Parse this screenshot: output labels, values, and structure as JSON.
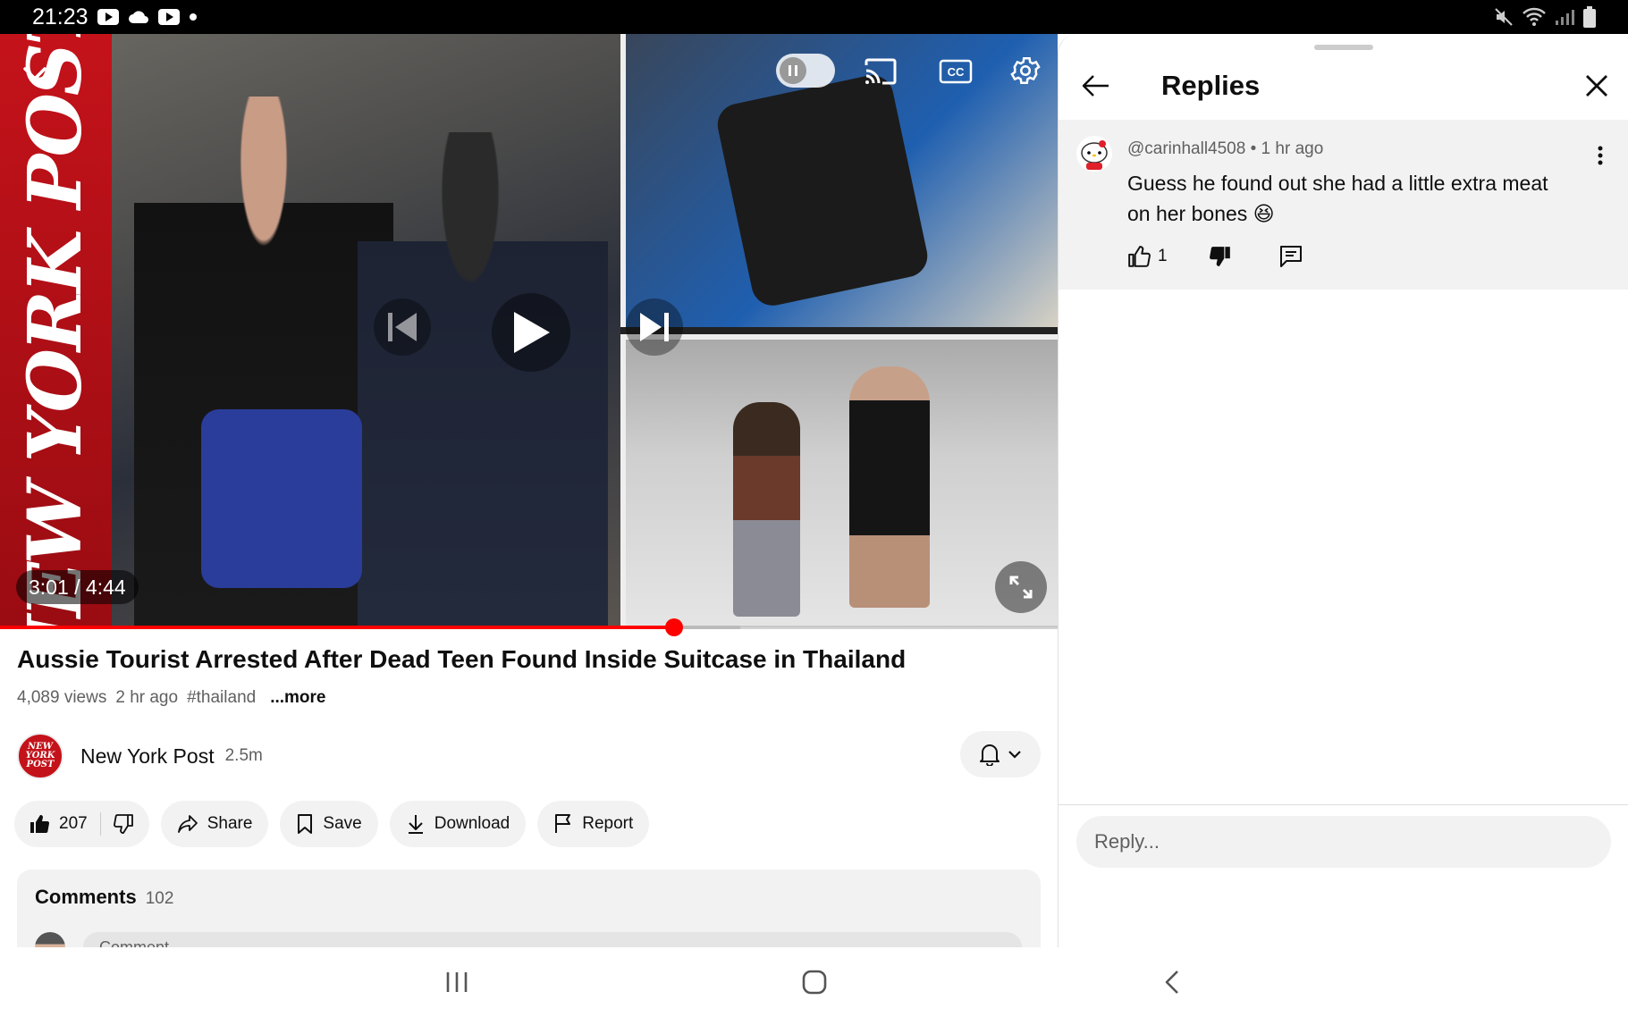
{
  "status_bar": {
    "time": "21:23",
    "left_icons": [
      "youtube-icon",
      "cloud-icon",
      "youtube-icon",
      "dot-icon"
    ],
    "right_icons": [
      "mute-icon",
      "wifi-icon",
      "signal-icon",
      "battery-icon"
    ]
  },
  "player": {
    "thumbnail_brand_text": "NEW YORK POST",
    "time_display": "3:01 / 4:44",
    "progress": 0.637,
    "buffered": 0.7,
    "controls": [
      "minimize-icon",
      "autoplay-toggle",
      "cast-icon",
      "captions-icon",
      "settings-icon",
      "previous-icon",
      "play-icon",
      "next-icon",
      "fullscreen-icon"
    ],
    "accent_color": "#ff0000"
  },
  "video": {
    "title": "Aussie Tourist Arrested After Dead Teen Found Inside Suitcase in Thailand",
    "views": "4,089 views",
    "age": "2 hr ago",
    "hashtag": "#thailand",
    "more_label": "...more"
  },
  "channel": {
    "avatar_text": "NEW YORK POST",
    "name": "New York Post",
    "subscribers": "2.5m"
  },
  "actions": {
    "like_count": "207",
    "share": "Share",
    "save": "Save",
    "download": "Download",
    "report": "Report"
  },
  "comments": {
    "title": "Comments",
    "count": "102",
    "placeholder": "Comment..."
  },
  "replies_panel": {
    "title": "Replies",
    "comment": {
      "author": "@carinhall4508",
      "age": "1 hr ago",
      "text": "Guess he found out she had a little extra meat on her bones 😆",
      "likes": "1"
    },
    "reply_placeholder": "Reply..."
  }
}
